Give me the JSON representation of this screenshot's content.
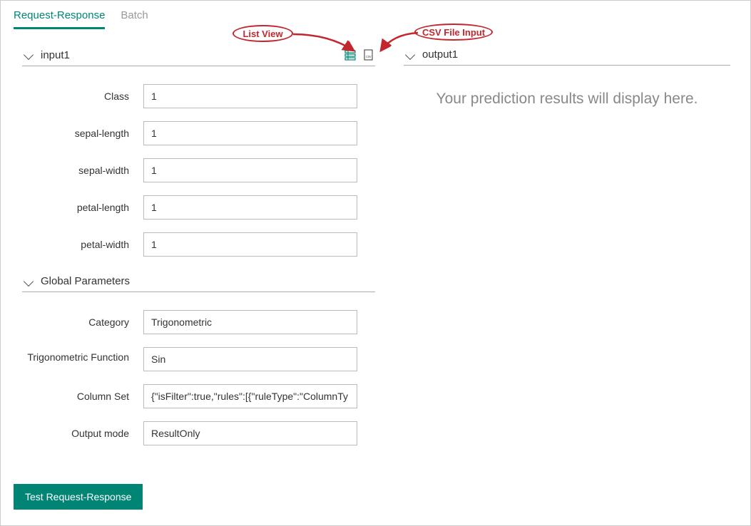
{
  "tabs": {
    "active": "Request-Response",
    "inactive": "Batch"
  },
  "input_section": {
    "title": "input1",
    "fields": [
      {
        "label": "Class",
        "value": "1"
      },
      {
        "label": "sepal-length",
        "value": "1"
      },
      {
        "label": "sepal-width",
        "value": "1"
      },
      {
        "label": "petal-length",
        "value": "1"
      },
      {
        "label": "petal-width",
        "value": "1"
      }
    ]
  },
  "global_section": {
    "title": "Global Parameters",
    "fields": [
      {
        "label": "Category",
        "value": "Trigonometric"
      },
      {
        "label": "Trigonometric Function",
        "value": "Sin"
      },
      {
        "label": "Column Set",
        "value": "{\"isFilter\":true,\"rules\":[{\"ruleType\":\"ColumnTy"
      },
      {
        "label": "Output mode",
        "value": "ResultOnly"
      }
    ]
  },
  "output_section": {
    "title": "output1",
    "placeholder": "Your prediction results will display here."
  },
  "buttons": {
    "test": "Test Request-Response"
  },
  "annotations": {
    "list_view": "List View",
    "csv_input": "CSV File Input"
  }
}
